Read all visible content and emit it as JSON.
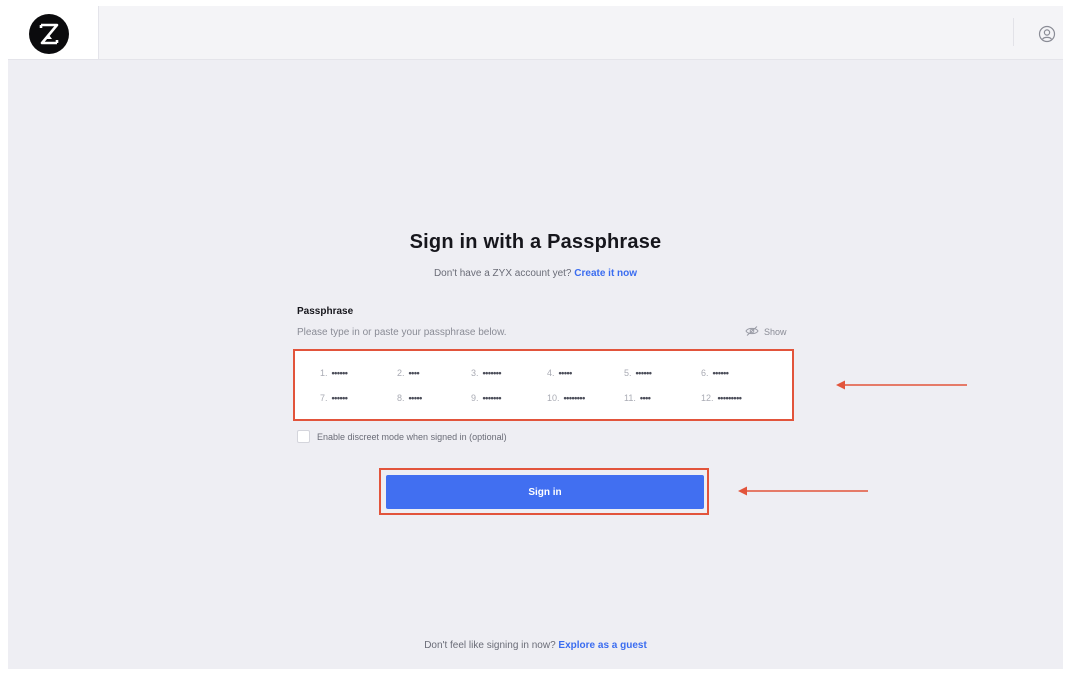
{
  "header": {
    "logo_icon": "hourglass-logo",
    "profile_icon": "user-circle-icon"
  },
  "title": "Sign in with a Passphrase",
  "subtitle": {
    "text": "Don't have a ZYX account yet?",
    "link": "Create it now"
  },
  "passphrase": {
    "label": "Passphrase",
    "help": "Please type in or paste your passphrase below.",
    "show_label": "Show",
    "words": [
      {
        "num": "1.",
        "mask": "••••••"
      },
      {
        "num": "2.",
        "mask": "••••"
      },
      {
        "num": "3.",
        "mask": "•••••••"
      },
      {
        "num": "4.",
        "mask": "•••••"
      },
      {
        "num": "5.",
        "mask": "••••••"
      },
      {
        "num": "6.",
        "mask": "••••••"
      },
      {
        "num": "7.",
        "mask": "••••••"
      },
      {
        "num": "8.",
        "mask": "•••••"
      },
      {
        "num": "9.",
        "mask": "•••••••"
      },
      {
        "num": "10.",
        "mask": "••••••••"
      },
      {
        "num": "11.",
        "mask": "••••"
      },
      {
        "num": "12.",
        "mask": "•••••••••"
      }
    ]
  },
  "discreet_mode": {
    "label": "Enable discreet mode when signed in (optional)",
    "checked": false
  },
  "signin_button": "Sign in",
  "guest": {
    "text": "Don't feel like signing in now?",
    "link": "Explore as a guest"
  },
  "colors": {
    "accent": "#416ff1",
    "highlight": "#e2543b",
    "background": "#eeeef3"
  }
}
